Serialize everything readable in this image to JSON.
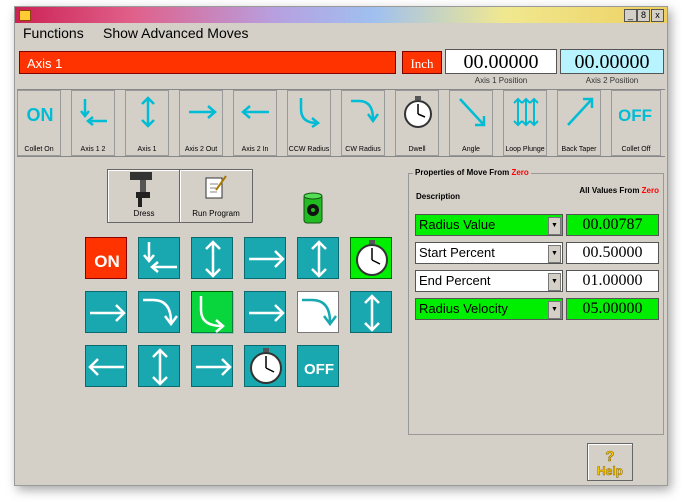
{
  "window": {
    "minimize": "_",
    "maximize": "8",
    "close": "x"
  },
  "menu": [
    "Functions",
    "Show Advanced Moves"
  ],
  "header": {
    "axis_title": "Axis 1",
    "unit": "Inch",
    "axis1_value": "00.00000",
    "axis1_label": "Axis 1 Position",
    "axis2_value": "00.00000",
    "axis2_label": "Axis 2 Position"
  },
  "toolbar": [
    {
      "label": "Collet On",
      "glyph": "ON",
      "icon": "on-text-icon"
    },
    {
      "label": "Axis 1 2",
      "icon": "axis12-arrow-icon"
    },
    {
      "label": "Axis 1",
      "icon": "updown-arrow-icon"
    },
    {
      "label": "Axis 2 Out",
      "icon": "right-arrow-icon"
    },
    {
      "label": "Axis 2 In",
      "icon": "left-arrow-icon"
    },
    {
      "label": "CCW Radius",
      "icon": "ccw-radius-icon"
    },
    {
      "label": "CW Radius",
      "icon": "cw-radius-icon"
    },
    {
      "label": "Dwell",
      "icon": "stopwatch-icon"
    },
    {
      "label": "Angle",
      "icon": "angle-arrow-icon"
    },
    {
      "label": "Loop Plunge",
      "icon": "loop-plunge-icon"
    },
    {
      "label": "Back Taper",
      "icon": "back-taper-icon"
    },
    {
      "label": "Collet Off",
      "glyph": "OFF",
      "icon": "off-text-icon"
    }
  ],
  "buttons": {
    "dress": "Dress",
    "run_program": "Run Program",
    "help": "Help"
  },
  "program_grid": [
    [
      "on",
      "axis12",
      "updown",
      "right",
      "updown",
      "dwell"
    ],
    [
      "right",
      "cw",
      "ccw-selected",
      "right",
      "cw-white",
      "updown"
    ],
    [
      "left",
      "updown",
      "right",
      "dwell",
      "off"
    ]
  ],
  "cell_text": {
    "on": "ON",
    "off": "OFF"
  },
  "properties": {
    "title_prefix": "Properties of Move From ",
    "title_zero": "Zero",
    "desc_header": "Description",
    "all_values_prefix": "All Values From ",
    "all_values_zero": "Zero",
    "rows": [
      {
        "name": "Radius Value",
        "value": "00.00787",
        "highlight": true
      },
      {
        "name": "Start Percent",
        "value": "00.50000",
        "highlight": false
      },
      {
        "name": "End Percent",
        "value": "01.00000",
        "highlight": false
      },
      {
        "name": "Radius Velocity",
        "value": "05.00000",
        "highlight": true
      }
    ]
  },
  "colors": {
    "red": "#ff3300",
    "teal": "#1aa8b0",
    "green": "#00ee00",
    "cyan": "#b8f4ff"
  }
}
